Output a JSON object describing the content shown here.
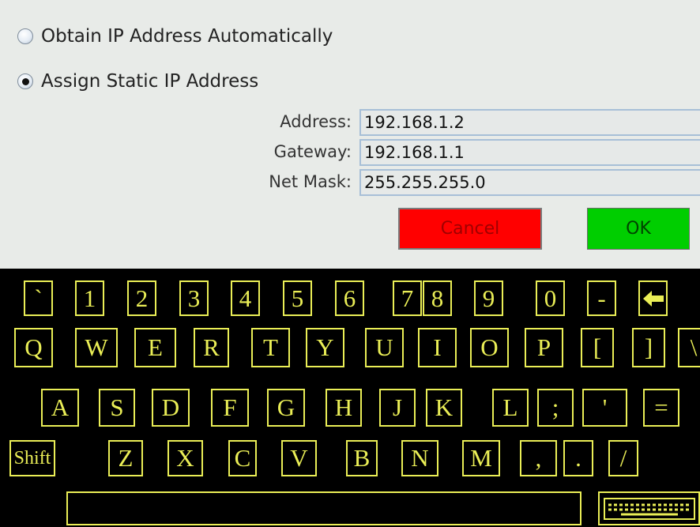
{
  "network": {
    "option_auto": "Obtain IP Address Automatically",
    "option_static": "Assign Static IP Address",
    "selected": "static",
    "fields": {
      "address": {
        "label": "Address:",
        "value": "192.168.1.2"
      },
      "gateway": {
        "label": "Gateway:",
        "value": "192.168.1.1"
      },
      "netmask": {
        "label": "Net Mask:",
        "value": "255.255.255.0"
      }
    },
    "cancel_label": "Cancel",
    "ok_label": "OK"
  },
  "keyboard": {
    "row1": [
      "`",
      "1",
      "2",
      "3",
      "4",
      "5",
      "6",
      "7",
      "8",
      "9",
      "0",
      "-"
    ],
    "backspace_icon": "backspace-arrow-icon",
    "row2": [
      "Q",
      "W",
      "E",
      "R",
      "T",
      "Y",
      "U",
      "I",
      "O",
      "P",
      "[",
      "]",
      "\\"
    ],
    "row3": [
      "A",
      "S",
      "D",
      "F",
      "G",
      "H",
      "J",
      "K",
      "L",
      ";",
      "'",
      "="
    ],
    "row4": [
      "Shift",
      "Z",
      "X",
      "C",
      "V",
      "B",
      "N",
      "M",
      ",",
      ".",
      "/"
    ],
    "keyboard_icon": "keyboard-icon",
    "colors": {
      "key": "#eaee56",
      "background": "#000000"
    }
  },
  "colors": {
    "panel": "#e8ebe8",
    "cancel": "#ff0000",
    "ok": "#00ce00",
    "field_border": "#a7bfd7"
  }
}
